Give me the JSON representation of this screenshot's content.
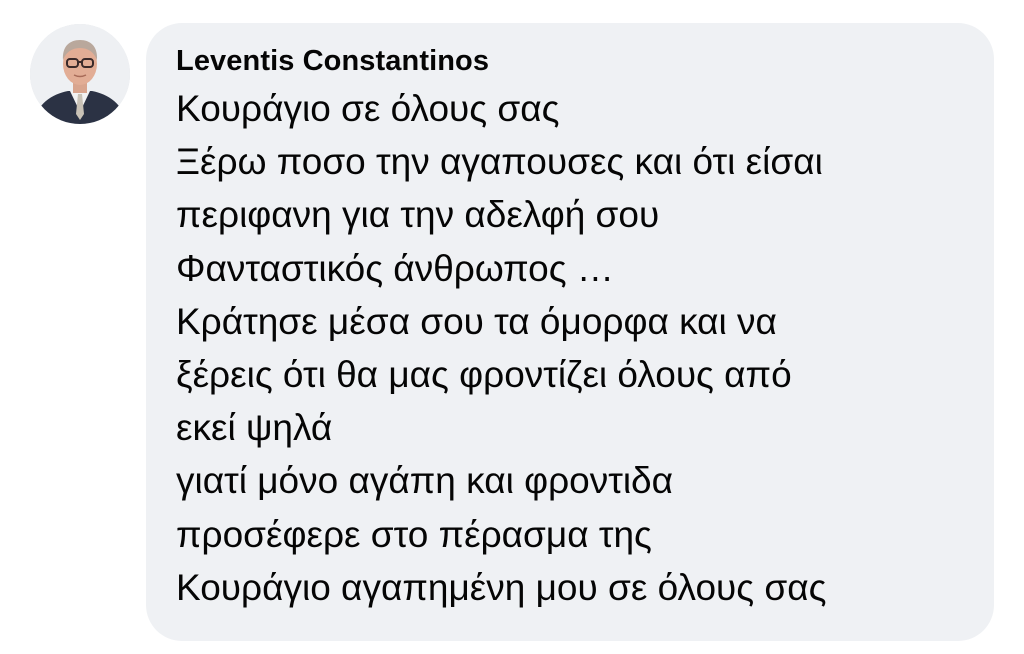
{
  "comment": {
    "author": "Leventis Constantinos",
    "avatar_icon": "profile-photo-avatar",
    "lines": [
      "Κουράγιο σε όλους σας",
      "Ξέρω ποσο την αγαπουσες και ότι είσαι",
      "περιφανη για την αδελφή σου",
      "Φανταστικός άνθρωπος …",
      "Κράτησε μέσα σου τα όμορφα και να",
      "ξέρεις ότι θα μας φροντίζει όλους από",
      "εκεί ψηλά",
      "γιατί μόνο αγάπη και φροντιδα",
      "προσέφερε στο πέρασμα της",
      "Κουράγιο αγαπημένη μου σε όλους σας"
    ]
  },
  "colors": {
    "bubble_background": "#eff1f4",
    "text": "#050505"
  }
}
